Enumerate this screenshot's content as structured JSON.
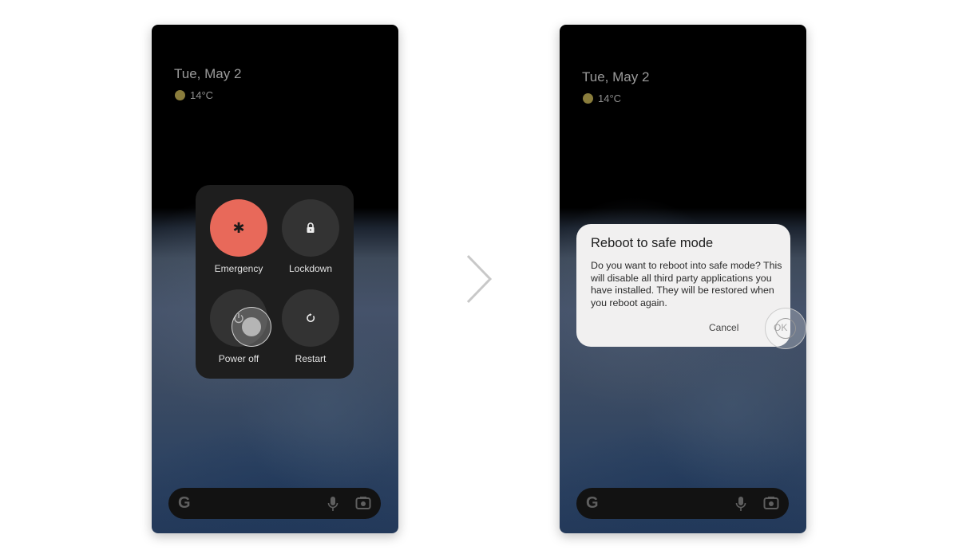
{
  "left_screen": {
    "date": "Tue, May 2",
    "weather": {
      "icon": "sun-icon",
      "temperature": "14°C"
    },
    "power_menu": {
      "buttons": [
        {
          "id": "emergency",
          "label": "Emergency",
          "icon": "asterisk-icon",
          "glyph": "✱"
        },
        {
          "id": "lockdown",
          "label": "Lockdown",
          "icon": "lock-icon"
        },
        {
          "id": "power-off",
          "label": "Power off",
          "icon": "power-icon"
        },
        {
          "id": "restart",
          "label": "Restart",
          "icon": "restart-icon"
        }
      ],
      "accent_color": "#e8695a"
    },
    "search_bar": {
      "logo": "G",
      "icons": [
        "mic-icon",
        "camera-lens-icon"
      ]
    }
  },
  "transition_arrow": "chevron-right-icon",
  "right_screen": {
    "date": "Tue, May 2",
    "weather": {
      "icon": "sun-icon",
      "temperature": "14°C"
    },
    "dialog": {
      "title": "Reboot to safe mode",
      "body": "Do you want to reboot into safe mode? This will disable all third party applications you have installed. They will be restored when you reboot again.",
      "cancel_label": "Cancel",
      "ok_label": "OK"
    },
    "search_bar": {
      "logo": "G",
      "icons": [
        "mic-icon",
        "camera-lens-icon"
      ]
    }
  }
}
